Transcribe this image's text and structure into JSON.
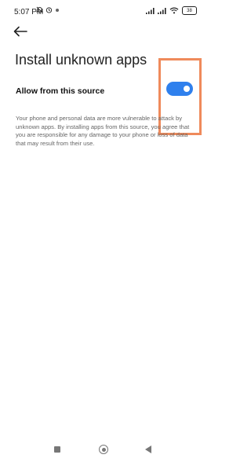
{
  "status_bar": {
    "time": "5:07 PM",
    "left_icons": [
      "alarm-off-icon",
      "alarm-clock-icon",
      "dot-icon"
    ],
    "right_icons": [
      "signal-icon",
      "signal-icon",
      "wifi-icon",
      "battery-icon"
    ],
    "battery_level": "38"
  },
  "header": {
    "back_icon": "back-arrow-icon",
    "title": "Install unknown apps"
  },
  "setting": {
    "label": "Allow from this source",
    "enabled": true,
    "accent_color": "#2f80ed"
  },
  "highlight_color": "#ef8a5b",
  "warning": {
    "text": "Your phone and personal data are more vulnerable to attack by unknown apps. By installing apps from this source, you agree that you are responsible for any damage to your phone or loss of data that may result from their use."
  },
  "nav_bar": {
    "icons": [
      "recents-square-icon",
      "home-circle-icon",
      "back-triangle-icon"
    ]
  }
}
